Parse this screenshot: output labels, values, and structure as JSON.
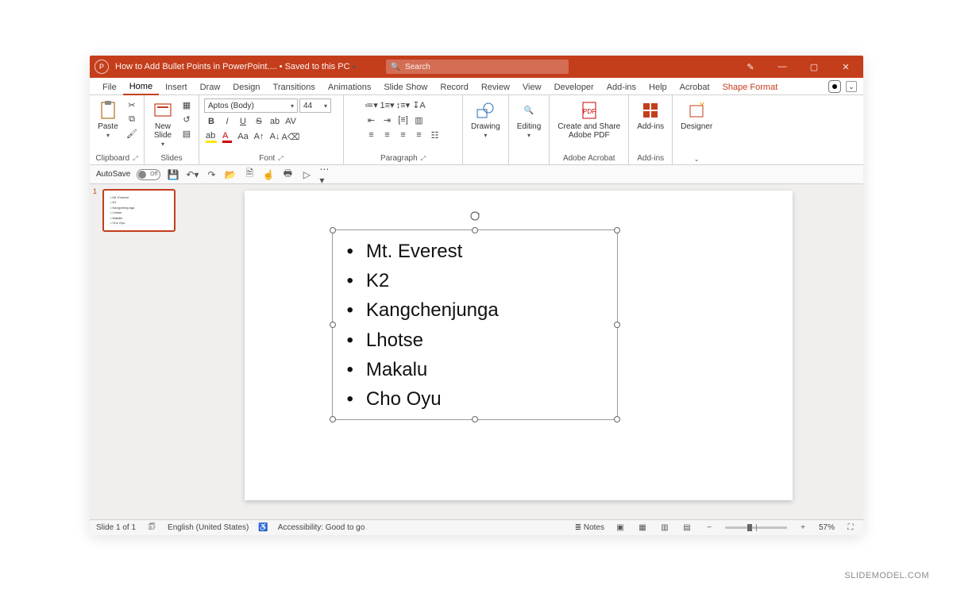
{
  "titlebar": {
    "doc_name": "How to Add Bullet Points in PowerPoint....",
    "save_state": "• Saved to this PC",
    "search_placeholder": "Search"
  },
  "tabs": [
    "File",
    "Home",
    "Insert",
    "Draw",
    "Design",
    "Transitions",
    "Animations",
    "Slide Show",
    "Record",
    "Review",
    "View",
    "Developer",
    "Add-ins",
    "Help",
    "Acrobat"
  ],
  "context_tab": "Shape Format",
  "active_tab": "Home",
  "ribbon": {
    "clipboard": {
      "paste": "Paste",
      "label": "Clipboard"
    },
    "slides": {
      "new_slide": "New\nSlide",
      "label": "Slides"
    },
    "font": {
      "name": "Aptos (Body)",
      "size": "44",
      "label": "Font"
    },
    "paragraph": {
      "label": "Paragraph"
    },
    "drawing": {
      "label": "Drawing"
    },
    "editing": {
      "label": "Editing"
    },
    "adobe": {
      "btn": "Create and Share\nAdobe PDF",
      "label": "Adobe Acrobat"
    },
    "addins": {
      "btn": "Add-ins",
      "label": "Add-ins"
    },
    "designer": {
      "btn": "Designer"
    }
  },
  "qat": {
    "autosave": "AutoSave",
    "autosave_state": "Off"
  },
  "slide_content": {
    "bullets": [
      "Mt. Everest",
      "K2",
      "Kangchenjunga",
      "Lhotse",
      "Makalu",
      "Cho Oyu"
    ]
  },
  "status": {
    "slide": "Slide 1 of 1",
    "lang": "English (United States)",
    "access": "Accessibility: Good to go",
    "notes": "Notes",
    "zoom": "57%"
  },
  "watermark": "SLIDEMODEL.COM"
}
